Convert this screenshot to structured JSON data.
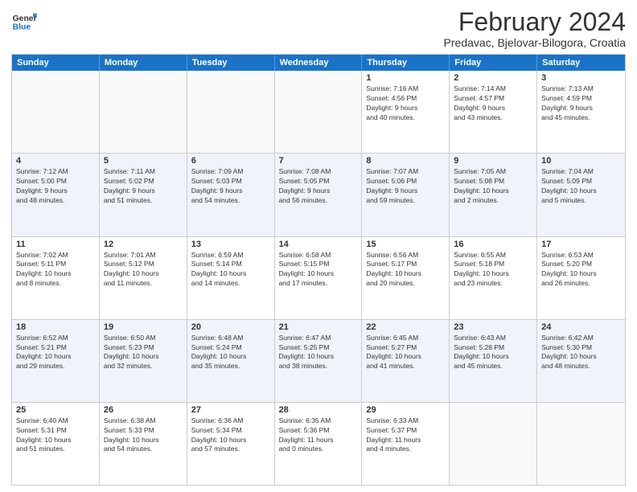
{
  "logo": {
    "text_general": "General",
    "text_blue": "Blue"
  },
  "header": {
    "title": "February 2024",
    "subtitle": "Predavac, Bjelovar-Bilogora, Croatia"
  },
  "day_headers": [
    "Sunday",
    "Monday",
    "Tuesday",
    "Wednesday",
    "Thursday",
    "Friday",
    "Saturday"
  ],
  "weeks": [
    [
      {
        "day": "",
        "info": "",
        "empty": true
      },
      {
        "day": "",
        "info": "",
        "empty": true
      },
      {
        "day": "",
        "info": "",
        "empty": true
      },
      {
        "day": "",
        "info": "",
        "empty": true
      },
      {
        "day": "1",
        "info": "Sunrise: 7:16 AM\nSunset: 4:56 PM\nDaylight: 9 hours\nand 40 minutes.",
        "empty": false
      },
      {
        "day": "2",
        "info": "Sunrise: 7:14 AM\nSunset: 4:57 PM\nDaylight: 9 hours\nand 43 minutes.",
        "empty": false
      },
      {
        "day": "3",
        "info": "Sunrise: 7:13 AM\nSunset: 4:59 PM\nDaylight: 9 hours\nand 45 minutes.",
        "empty": false
      }
    ],
    [
      {
        "day": "4",
        "info": "Sunrise: 7:12 AM\nSunset: 5:00 PM\nDaylight: 9 hours\nand 48 minutes.",
        "empty": false
      },
      {
        "day": "5",
        "info": "Sunrise: 7:11 AM\nSunset: 5:02 PM\nDaylight: 9 hours\nand 51 minutes.",
        "empty": false
      },
      {
        "day": "6",
        "info": "Sunrise: 7:09 AM\nSunset: 5:03 PM\nDaylight: 9 hours\nand 54 minutes.",
        "empty": false
      },
      {
        "day": "7",
        "info": "Sunrise: 7:08 AM\nSunset: 5:05 PM\nDaylight: 9 hours\nand 56 minutes.",
        "empty": false
      },
      {
        "day": "8",
        "info": "Sunrise: 7:07 AM\nSunset: 5:06 PM\nDaylight: 9 hours\nand 59 minutes.",
        "empty": false
      },
      {
        "day": "9",
        "info": "Sunrise: 7:05 AM\nSunset: 5:08 PM\nDaylight: 10 hours\nand 2 minutes.",
        "empty": false
      },
      {
        "day": "10",
        "info": "Sunrise: 7:04 AM\nSunset: 5:09 PM\nDaylight: 10 hours\nand 5 minutes.",
        "empty": false
      }
    ],
    [
      {
        "day": "11",
        "info": "Sunrise: 7:02 AM\nSunset: 5:11 PM\nDaylight: 10 hours\nand 8 minutes.",
        "empty": false
      },
      {
        "day": "12",
        "info": "Sunrise: 7:01 AM\nSunset: 5:12 PM\nDaylight: 10 hours\nand 11 minutes.",
        "empty": false
      },
      {
        "day": "13",
        "info": "Sunrise: 6:59 AM\nSunset: 5:14 PM\nDaylight: 10 hours\nand 14 minutes.",
        "empty": false
      },
      {
        "day": "14",
        "info": "Sunrise: 6:58 AM\nSunset: 5:15 PM\nDaylight: 10 hours\nand 17 minutes.",
        "empty": false
      },
      {
        "day": "15",
        "info": "Sunrise: 6:56 AM\nSunset: 5:17 PM\nDaylight: 10 hours\nand 20 minutes.",
        "empty": false
      },
      {
        "day": "16",
        "info": "Sunrise: 6:55 AM\nSunset: 5:18 PM\nDaylight: 10 hours\nand 23 minutes.",
        "empty": false
      },
      {
        "day": "17",
        "info": "Sunrise: 6:53 AM\nSunset: 5:20 PM\nDaylight: 10 hours\nand 26 minutes.",
        "empty": false
      }
    ],
    [
      {
        "day": "18",
        "info": "Sunrise: 6:52 AM\nSunset: 5:21 PM\nDaylight: 10 hours\nand 29 minutes.",
        "empty": false
      },
      {
        "day": "19",
        "info": "Sunrise: 6:50 AM\nSunset: 5:23 PM\nDaylight: 10 hours\nand 32 minutes.",
        "empty": false
      },
      {
        "day": "20",
        "info": "Sunrise: 6:48 AM\nSunset: 5:24 PM\nDaylight: 10 hours\nand 35 minutes.",
        "empty": false
      },
      {
        "day": "21",
        "info": "Sunrise: 6:47 AM\nSunset: 5:25 PM\nDaylight: 10 hours\nand 38 minutes.",
        "empty": false
      },
      {
        "day": "22",
        "info": "Sunrise: 6:45 AM\nSunset: 5:27 PM\nDaylight: 10 hours\nand 41 minutes.",
        "empty": false
      },
      {
        "day": "23",
        "info": "Sunrise: 6:43 AM\nSunset: 5:28 PM\nDaylight: 10 hours\nand 45 minutes.",
        "empty": false
      },
      {
        "day": "24",
        "info": "Sunrise: 6:42 AM\nSunset: 5:30 PM\nDaylight: 10 hours\nand 48 minutes.",
        "empty": false
      }
    ],
    [
      {
        "day": "25",
        "info": "Sunrise: 6:40 AM\nSunset: 5:31 PM\nDaylight: 10 hours\nand 51 minutes.",
        "empty": false
      },
      {
        "day": "26",
        "info": "Sunrise: 6:38 AM\nSunset: 5:33 PM\nDaylight: 10 hours\nand 54 minutes.",
        "empty": false
      },
      {
        "day": "27",
        "info": "Sunrise: 6:36 AM\nSunset: 5:34 PM\nDaylight: 10 hours\nand 57 minutes.",
        "empty": false
      },
      {
        "day": "28",
        "info": "Sunrise: 6:35 AM\nSunset: 5:36 PM\nDaylight: 11 hours\nand 0 minutes.",
        "empty": false
      },
      {
        "day": "29",
        "info": "Sunrise: 6:33 AM\nSunset: 5:37 PM\nDaylight: 11 hours\nand 4 minutes.",
        "empty": false
      },
      {
        "day": "",
        "info": "",
        "empty": true
      },
      {
        "day": "",
        "info": "",
        "empty": true
      }
    ]
  ]
}
